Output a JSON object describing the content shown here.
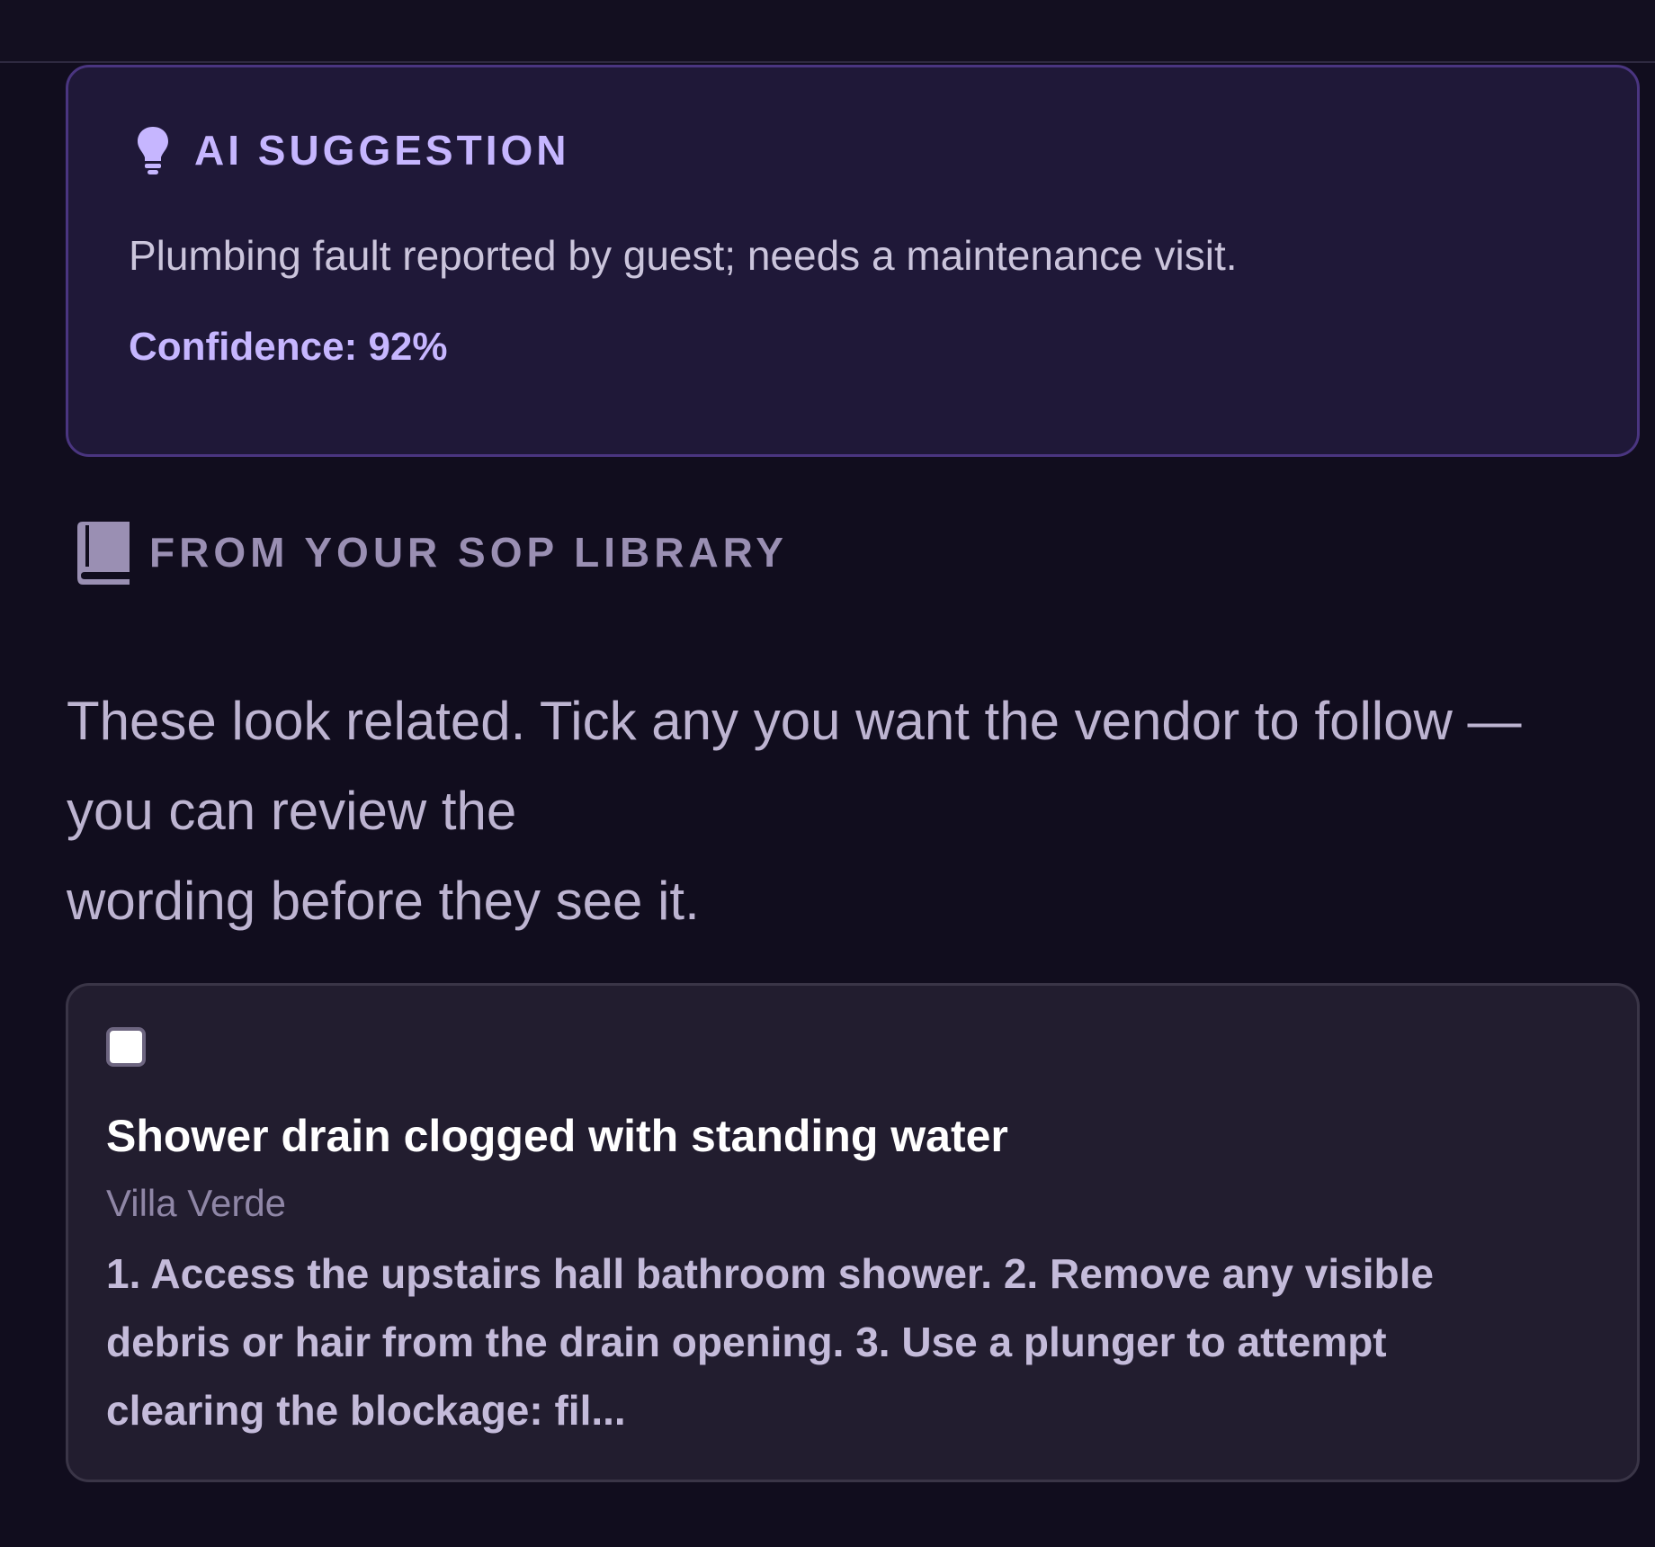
{
  "ai_suggestion": {
    "icon": "lightbulb-icon",
    "title": "AI SUGGESTION",
    "summary": "Plumbing fault reported by guest; needs a maintenance visit.",
    "confidence_text": "Confidence: 92%",
    "confidence": 0.92
  },
  "sop_library": {
    "icon": "book-icon",
    "title": "FROM YOUR SOP LIBRARY",
    "intro_lines": [
      "These look related. Tick any you want the vendor to follow —",
      "you can review the",
      "wording before they see it."
    ],
    "items": [
      {
        "checked": false,
        "title": "Shower drain clogged with standing water",
        "property": "Villa Verde",
        "body_lines": [
          "1. Access the upstairs hall bathroom shower. 2. Remove any visible",
          "debris or hair from the drain opening. 3. Use a plunger to attempt",
          "clearing the blockage: fil..."
        ]
      }
    ]
  },
  "colors": {
    "background": "#110d1e",
    "ai_card_bg": "#1f1838",
    "ai_card_border": "#4a3580",
    "accent": "#c6b6ff",
    "sop_card_bg": "#221d2f"
  }
}
